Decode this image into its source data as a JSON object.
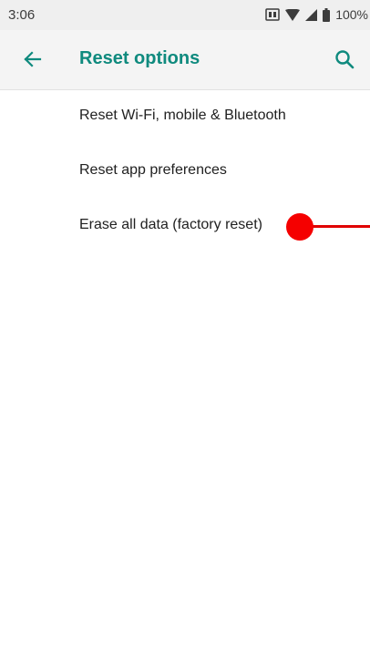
{
  "status_bar": {
    "time": "3:06",
    "battery_text": "100%",
    "icons": [
      "screenshot-icon",
      "wifi-icon",
      "signal-icon",
      "battery-icon"
    ]
  },
  "app_bar": {
    "title": "Reset options",
    "accent_color": "#0f8a7e",
    "icons": [
      "back-arrow-icon",
      "search-icon"
    ]
  },
  "options": [
    {
      "label": "Reset Wi-Fi, mobile & Bluetooth"
    },
    {
      "label": "Reset app preferences"
    },
    {
      "label": "Erase all data (factory reset)"
    }
  ],
  "annotation": {
    "color": "#f50000"
  }
}
